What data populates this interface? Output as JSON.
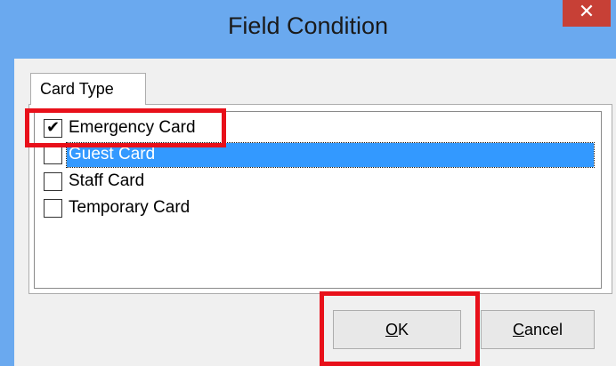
{
  "window": {
    "title": "Field Condition",
    "close_glyph": "✕"
  },
  "tabs": [
    {
      "label": "Card Type",
      "active": true
    }
  ],
  "list": {
    "items": [
      {
        "label": "Emergency Card",
        "checked": true,
        "selected": false
      },
      {
        "label": "Guest Card",
        "checked": false,
        "selected": true
      },
      {
        "label": "Staff Card",
        "checked": false,
        "selected": false
      },
      {
        "label": "Temporary Card",
        "checked": false,
        "selected": false
      }
    ]
  },
  "buttons": {
    "ok": {
      "mnemonic": "O",
      "rest": "K"
    },
    "cancel": {
      "mnemonic": "C",
      "rest": "ancel"
    }
  },
  "colors": {
    "titlebar": "#6aa9ef",
    "close": "#c74036",
    "selection": "#3399ff",
    "highlight": "#e8101a"
  },
  "icons": {
    "close": "close-icon",
    "check": "check-icon"
  }
}
